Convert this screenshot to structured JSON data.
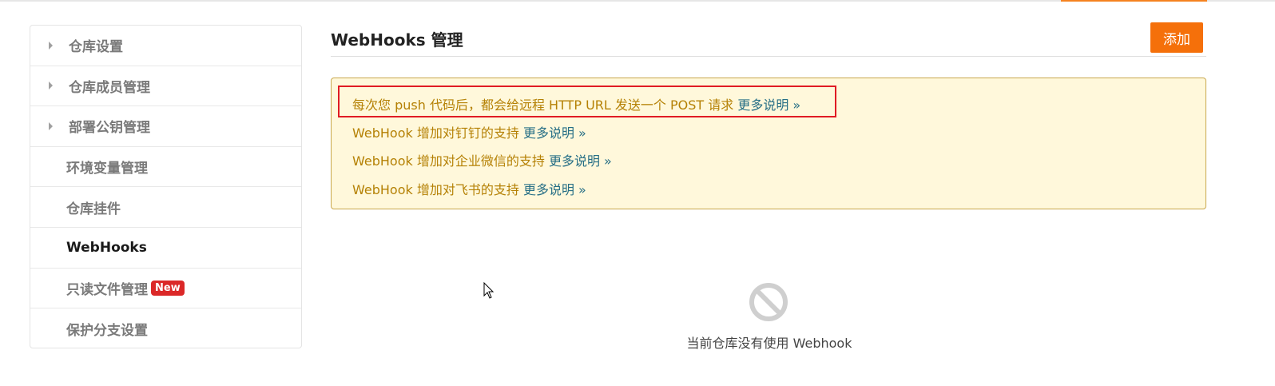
{
  "sidebar": {
    "items": [
      {
        "label": "仓库设置"
      },
      {
        "label": "仓库成员管理"
      },
      {
        "label": "部署公钥管理"
      },
      {
        "label": "环境变量管理"
      },
      {
        "label": "仓库挂件"
      },
      {
        "label": "WebHooks"
      },
      {
        "label": "只读文件管理",
        "badge": "New"
      },
      {
        "label": "保护分支设置"
      }
    ]
  },
  "main": {
    "title": "WebHooks 管理",
    "add_label": "添加",
    "notices": [
      {
        "text": "每次您 push 代码后，都会给远程 HTTP URL 发送一个 POST 请求 ",
        "link": "更多说明 »"
      },
      {
        "text": "WebHook 增加对钉钉的支持 ",
        "link": "更多说明 »"
      },
      {
        "text": "WebHook 增加对企业微信的支持 ",
        "link": "更多说明 »"
      },
      {
        "text": "WebHook 增加对飞书的支持 ",
        "link": "更多说明 »"
      }
    ],
    "empty_state": {
      "icon": "ban-icon",
      "text": "当前仓库没有使用 Webhook"
    }
  },
  "colors": {
    "accent": "#f5700a",
    "notice_bg": "#fff8db",
    "notice_text": "#b58105",
    "link": "#276f86",
    "badge": "#db2828",
    "highlight": "#e01b24"
  }
}
